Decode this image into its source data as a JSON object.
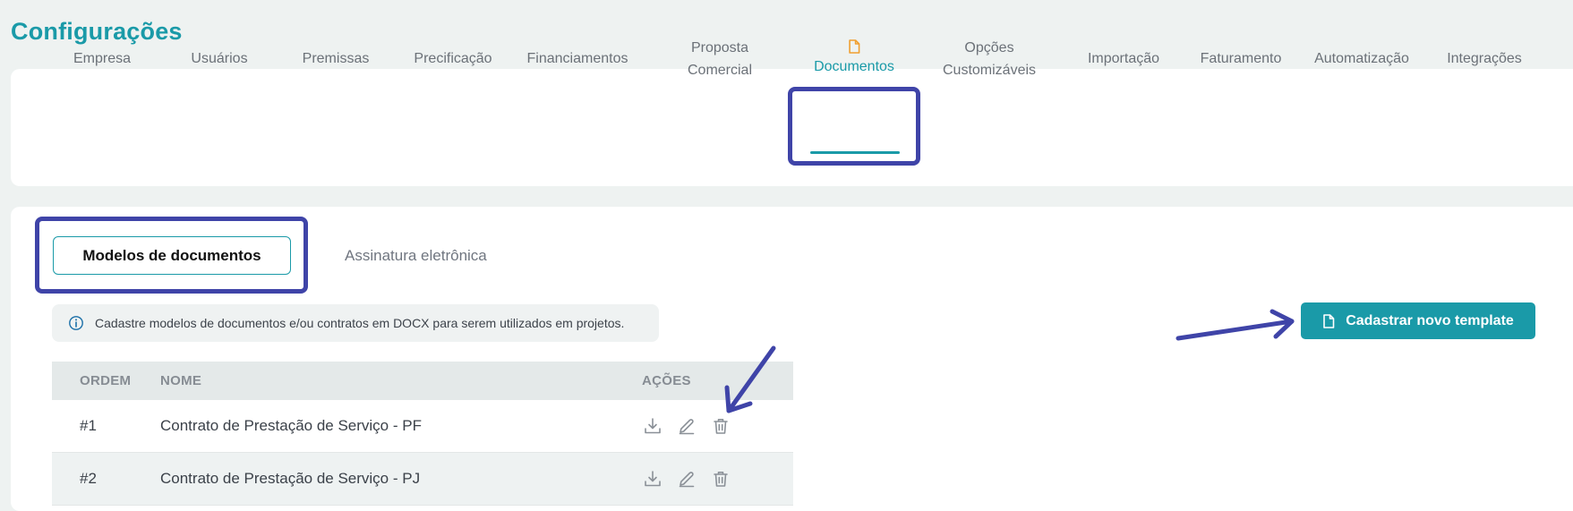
{
  "page": {
    "title": "Configurações"
  },
  "nav": {
    "items": [
      {
        "id": "empresa",
        "label_lines": [
          "Empresa"
        ]
      },
      {
        "id": "usuarios",
        "label_lines": [
          "Usuários"
        ]
      },
      {
        "id": "premissas",
        "label_lines": [
          "Premissas"
        ]
      },
      {
        "id": "precificacao",
        "label_lines": [
          "Precificação"
        ]
      },
      {
        "id": "financiamentos",
        "label_lines": [
          "Financiamentos"
        ]
      },
      {
        "id": "proposta",
        "label_lines": [
          "Proposta",
          "Comercial"
        ]
      },
      {
        "id": "documentos",
        "label_lines": [
          "Documentos"
        ],
        "active": true,
        "icon": "document-icon"
      },
      {
        "id": "opcoes",
        "label_lines": [
          "Opções",
          "Customizáveis"
        ]
      },
      {
        "id": "importacao",
        "label_lines": [
          "Importação"
        ]
      },
      {
        "id": "faturamento",
        "label_lines": [
          "Faturamento"
        ]
      },
      {
        "id": "automatizacao",
        "label_lines": [
          "Automatização"
        ]
      },
      {
        "id": "integracoes",
        "label_lines": [
          "Integrações"
        ]
      }
    ]
  },
  "subtabs": {
    "active": "Modelos de documentos",
    "inactive": "Assinatura eletrônica"
  },
  "info": {
    "icon": "info-icon",
    "text": "Cadastre modelos de documentos e/ou contratos em DOCX para serem utilizados em projetos."
  },
  "actions": {
    "new_template_label": "Cadastrar novo template",
    "new_template_icon": "document-icon"
  },
  "table": {
    "headers": {
      "ordem": "ORDEM",
      "nome": "NOME",
      "acoes": "AÇÕES"
    },
    "rows": [
      {
        "ordem": "#1",
        "nome": "Contrato de Prestação de Serviço - PF"
      },
      {
        "ordem": "#2",
        "nome": "Contrato de Prestação de Serviço - PJ"
      }
    ],
    "row_actions": [
      "download-icon",
      "edit-icon",
      "trash-icon"
    ]
  },
  "colors": {
    "accent": "#1a9aa8",
    "annotation": "#3f44a8",
    "active_icon": "#f0a030",
    "background": "#eef2f1"
  }
}
